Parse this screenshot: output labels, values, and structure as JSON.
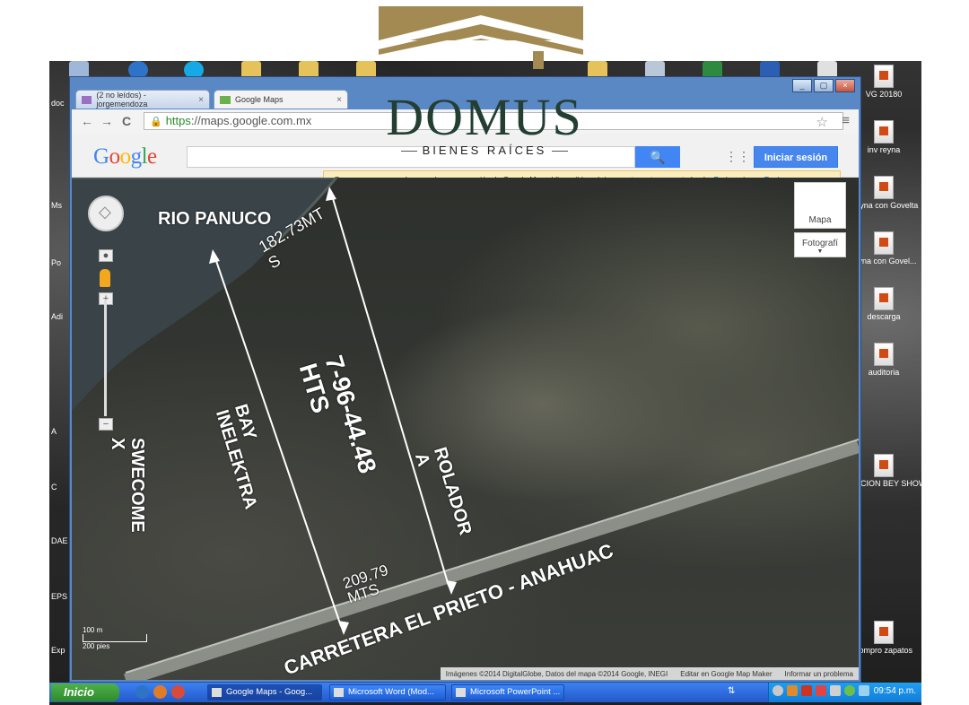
{
  "desktop": {
    "left_labels": [
      "doc",
      "Ms",
      "Po",
      "Adi",
      "A",
      "C",
      "DAE",
      "EPS",
      "Exp"
    ],
    "right_icons": [
      {
        "label": "VG 20180"
      },
      {
        "label": "inv reyna"
      },
      {
        "label": "Reyna con Govelta"
      },
      {
        "label": "reyna con Govel..."
      },
      {
        "label": "descarga"
      },
      {
        "label": "auditoria"
      },
      {
        "label": "INVITACION BEY SHOW..."
      },
      {
        "label": "compro zapatos"
      }
    ]
  },
  "browser": {
    "tabs": [
      {
        "label": "(2 no leídos) - jorgemendoza",
        "close": "×"
      },
      {
        "label": "Google Maps",
        "close": "×"
      }
    ],
    "window_controls": {
      "minimize": "_",
      "maximize": "▢",
      "close": "×"
    },
    "nav": {
      "back": "←",
      "forward": "→",
      "reload": "C"
    },
    "url": {
      "scheme": "https",
      "rest": "://maps.google.com.mx",
      "lock": "🔒"
    },
    "star": "☆",
    "menu": "≡"
  },
  "google_bar": {
    "logo": [
      "G",
      "o",
      "o",
      "g",
      "l",
      "e"
    ],
    "logo_colors": [
      "#4285f4",
      "#ea4335",
      "#fbbc05",
      "#4285f4",
      "#34a853",
      "#ea4335"
    ],
    "search_icon": "🔍",
    "apps_icon": "⋮⋮⋮",
    "sign_in": "Iniciar sesión",
    "notice": "Busca, navega y explora con la nueva versión de Google Maps (disponible próximamente en tu computadora).",
    "notice_try": "Probar ahora",
    "notice_reject": "Rechazar"
  },
  "map": {
    "map_type": {
      "map": "Mapa",
      "satellite": "Fotografí"
    },
    "scale": {
      "m": "100 m",
      "ft": "200 pies"
    },
    "zoom_in": "+",
    "zoom_out": "−",
    "credits": {
      "imagery": "Imágenes ©2014 DigitalGlobe, Datos del mapa ©2014 Google, INEGI",
      "edit": "Editar en Google Map Maker",
      "report": "Informar un problema"
    },
    "annotations": {
      "river": "RIO PANUCO",
      "north_measure_1": "182.73MT",
      "north_measure_2": "S",
      "area_1": "7-96-44.48",
      "area_2": "HTS",
      "west_1": "BAY",
      "west_2": "INELEKTRA",
      "far_west_1": "SWECOME",
      "far_west_2": "X",
      "east_1": "ROLADOR",
      "east_2": "A",
      "south_measure_1": "209.79",
      "south_measure_2": "MTS",
      "road": "CARRETERA EL PRIETO - ANAHUAC"
    }
  },
  "taskbar": {
    "start": "Inicio",
    "buttons": [
      {
        "label": "Google Maps - Goog..."
      },
      {
        "label": "Microsoft Word (Mod..."
      },
      {
        "label": "Microsoft PowerPoint ..."
      }
    ],
    "clock": "09:54 p.m."
  },
  "logo": {
    "main": "DOMUS",
    "sub": "BIENES RAÍCES",
    "color_gold": "#a28a52",
    "color_green": "#223f32"
  }
}
